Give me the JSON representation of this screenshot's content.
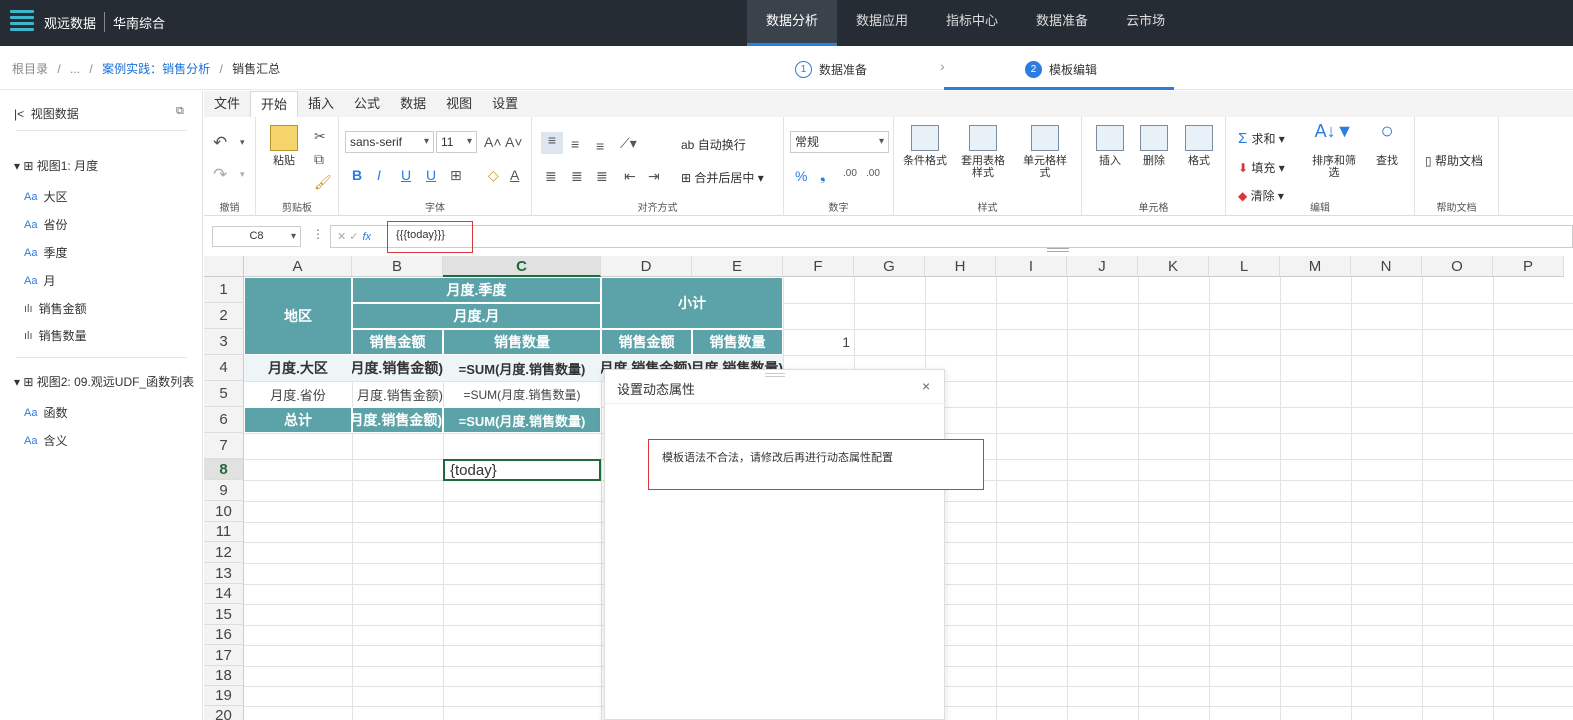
{
  "topbar": {
    "brand": "观远数据",
    "sub": "华南综合",
    "nav": [
      "数据分析",
      "数据应用",
      "指标中心",
      "数据准备",
      "云市场"
    ]
  },
  "breadcrumb": {
    "root": "根目录",
    "ellipsis": "...",
    "link": "案例实践：销售分析",
    "current": "销售汇总",
    "sep": "/"
  },
  "steps": [
    {
      "num": "1",
      "label": "数据准备"
    },
    {
      "num": "2",
      "label": "模板编辑"
    }
  ],
  "sidebar": {
    "title": "视图数据",
    "view1": {
      "label": "视图1: 月度",
      "items": [
        {
          "type": "Aa",
          "label": "大区"
        },
        {
          "type": "Aa",
          "label": "省份"
        },
        {
          "type": "Aa",
          "label": "季度"
        },
        {
          "type": "Aa",
          "label": "月"
        },
        {
          "type": "bar",
          "label": "销售金额"
        },
        {
          "type": "bar",
          "label": "销售数量"
        }
      ]
    },
    "view2": {
      "label": "视图2: 09.观远UDF_函数列表",
      "items": [
        {
          "type": "Aa",
          "label": "函数"
        },
        {
          "type": "Aa",
          "label": "含义"
        }
      ]
    }
  },
  "tabs": [
    "文件",
    "开始",
    "插入",
    "公式",
    "数据",
    "视图",
    "设置"
  ],
  "ribbon": {
    "groups": {
      "undo": "撤销",
      "clipboard": "剪贴板",
      "font": "字体",
      "align": "对齐方式",
      "number": "数字",
      "style": "样式",
      "cells": "单元格",
      "edit": "编辑",
      "help": "帮助文档"
    },
    "paste": "粘贴",
    "font_name": "sans-serif",
    "font_size": "11",
    "wrap": "自动换行",
    "merge": "合并后居中",
    "number_format": "常规",
    "cond_format": "条件格式",
    "table_style": "套用表格样式",
    "cell_style": "单元格样式",
    "insert": "插入",
    "delete": "删除",
    "format": "格式",
    "sum": "求和",
    "fill": "填充",
    "clear": "清除",
    "sort_filter": "排序和筛选",
    "find": "查找",
    "help_doc": "帮助文档"
  },
  "formula_bar": {
    "name": "C8",
    "fx": "fx",
    "value": "{{{today}}}"
  },
  "columns": [
    "A",
    "B",
    "C",
    "D",
    "E",
    "F",
    "G",
    "H",
    "I",
    "J",
    "K",
    "L",
    "M",
    "N",
    "O",
    "P"
  ],
  "rows": [
    "1",
    "2",
    "3",
    "4",
    "5",
    "6",
    "7",
    "8",
    "9",
    "10",
    "11",
    "12",
    "13",
    "14",
    "15",
    "16",
    "17",
    "18",
    "19",
    "20"
  ],
  "cells": {
    "region": "地区",
    "month_quarter": "月度.季度",
    "month_month": "月度.月",
    "subtotal": "小计",
    "b3": "销售金额",
    "c3": "销售数量",
    "d3": "销售金额",
    "e3": "销售数量",
    "f3": "1",
    "a4": "月度.大区",
    "b4": "月度.销售金额)",
    "c4": "=SUM(月度.销售数量)",
    "d4": "月度.销售金额)",
    "e4": "月度.销售数量)",
    "a5": "月度.省份",
    "b5": "月度.销售金额)",
    "c5": "=SUM(月度.销售数量)",
    "a6": "总计",
    "b6": "月度.销售金额)",
    "c6": "=SUM(月度.销售数量)",
    "c8": "{today}"
  },
  "dialog": {
    "title": "设置动态属性",
    "close": "×",
    "error": "模板语法不合法，请修改后再进行动态属性配置"
  },
  "colors": {
    "teal": "#5ba3a8",
    "topbar": "#262c33",
    "accent": "#2a7de1",
    "error": "#d9363e"
  }
}
